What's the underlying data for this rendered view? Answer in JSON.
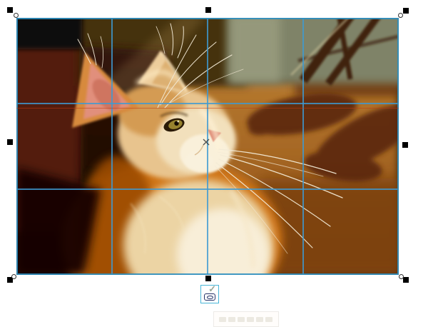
{
  "app": {
    "view": "image-crop-editing-canvas",
    "background": "#ffffff"
  },
  "crop_tool": {
    "grid": {
      "columns": 4,
      "rows": 3
    },
    "handles": [
      "top-left",
      "top-center",
      "top-right",
      "middle-left",
      "middle-right",
      "bottom-left",
      "bottom-center",
      "bottom-right"
    ]
  },
  "colors": {
    "crop_border": "#2e8fc0",
    "grid_line": "#3e9ad2",
    "guideline": "#c03a10",
    "handle_fill": "#000000",
    "apply_button_border": "#49b6d8",
    "apply_check": "#9aa898",
    "apply_glyph": "#232f66"
  },
  "icons": {
    "checkmark": "✓"
  }
}
